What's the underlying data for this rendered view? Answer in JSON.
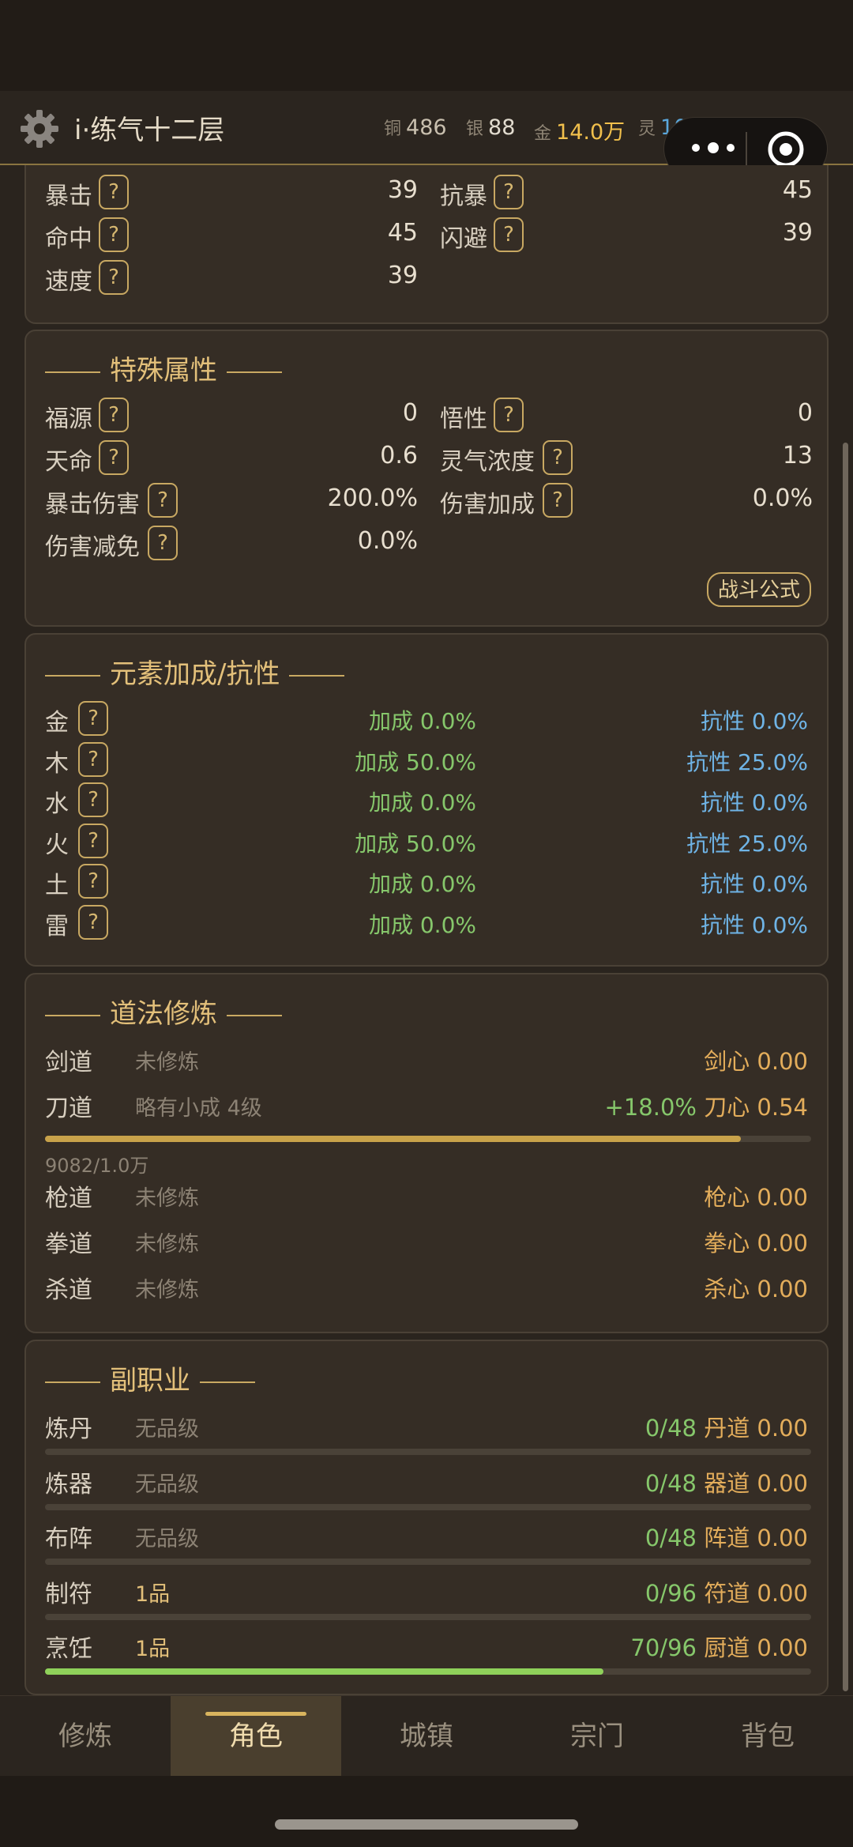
{
  "header": {
    "title": "i·练气十二层",
    "currencies": [
      {
        "label": "铜",
        "value": "486",
        "color": "#c8bfae"
      },
      {
        "label": "银",
        "value": "88",
        "color": "#e2dccf"
      },
      {
        "label": "金",
        "value": "14.0万",
        "color": "#f1c04c"
      },
      {
        "label": "灵",
        "value": "103",
        "color": "#5aa7dc"
      }
    ]
  },
  "basic": {
    "rows": [
      {
        "left": {
          "label": "暴击",
          "value": "39"
        },
        "right": {
          "label": "抗暴",
          "value": "45"
        }
      },
      {
        "left": {
          "label": "命中",
          "value": "45"
        },
        "right": {
          "label": "闪避",
          "value": "39"
        }
      },
      {
        "left": {
          "label": "速度",
          "value": "39"
        }
      }
    ]
  },
  "special": {
    "title": "特殊属性",
    "rows": [
      {
        "left": {
          "label": "福源",
          "value": "0"
        },
        "right": {
          "label": "悟性",
          "value": "0"
        }
      },
      {
        "left": {
          "label": "天命",
          "value": "0.6"
        },
        "right": {
          "label": "灵气浓度",
          "value": "13"
        }
      },
      {
        "left": {
          "label": "暴击伤害",
          "value": "200.0%"
        },
        "right": {
          "label": "伤害加成",
          "value": "0.0%"
        }
      },
      {
        "left": {
          "label": "伤害减免",
          "value": "0.0%"
        }
      }
    ],
    "formula_button": "战斗公式"
  },
  "elements": {
    "title": "元素加成/抗性",
    "rows": [
      {
        "name": "金",
        "bonus": "加成 0.0%",
        "resist": "抗性 0.0%"
      },
      {
        "name": "木",
        "bonus": "加成 50.0%",
        "resist": "抗性 25.0%"
      },
      {
        "name": "水",
        "bonus": "加成 0.0%",
        "resist": "抗性 0.0%"
      },
      {
        "name": "火",
        "bonus": "加成 50.0%",
        "resist": "抗性 25.0%"
      },
      {
        "name": "土",
        "bonus": "加成 0.0%",
        "resist": "抗性 0.0%"
      },
      {
        "name": "雷",
        "bonus": "加成 0.0%",
        "resist": "抗性 0.0%"
      }
    ]
  },
  "dao": {
    "title": "道法修炼",
    "rows": [
      {
        "name": "剑道",
        "status": "未修炼",
        "bonus": "",
        "heart": "剑心",
        "value": "0.00"
      },
      {
        "name": "刀道",
        "status": "略有小成 4级",
        "bonus": "+18.0%",
        "heart": "刀心",
        "value": "0.54",
        "progress_text": "9082/1.0万",
        "progress": 0.908
      },
      {
        "name": "枪道",
        "status": "未修炼",
        "bonus": "",
        "heart": "枪心",
        "value": "0.00"
      },
      {
        "name": "拳道",
        "status": "未修炼",
        "bonus": "",
        "heart": "拳心",
        "value": "0.00"
      },
      {
        "name": "杀道",
        "status": "未修炼",
        "bonus": "",
        "heart": "杀心",
        "value": "0.00"
      }
    ]
  },
  "profession": {
    "title": "副职业",
    "rows": [
      {
        "name": "炼丹",
        "grade": "无品级",
        "count": "0/48",
        "dao": "丹道",
        "value": "0.00",
        "progress": 0
      },
      {
        "name": "炼器",
        "grade": "无品级",
        "count": "0/48",
        "dao": "器道",
        "value": "0.00",
        "progress": 0
      },
      {
        "name": "布阵",
        "grade": "无品级",
        "count": "0/48",
        "dao": "阵道",
        "value": "0.00",
        "progress": 0
      },
      {
        "name": "制符",
        "grade": "1品",
        "count": "0/96",
        "dao": "符道",
        "value": "0.00",
        "progress": 0
      },
      {
        "name": "烹饪",
        "grade": "1品",
        "count": "70/96",
        "dao": "厨道",
        "value": "0.00",
        "progress": 0.729
      }
    ]
  },
  "tabs": [
    "修炼",
    "角色",
    "城镇",
    "宗门",
    "背包"
  ],
  "active_tab": 1,
  "colors": {
    "accent": "#d9b45e",
    "green": "#86c76b",
    "blue": "#6fb4e6",
    "orange": "#e3ad5b",
    "bar_green": "#8fd15a",
    "bar_gold": "#c8a24a"
  }
}
